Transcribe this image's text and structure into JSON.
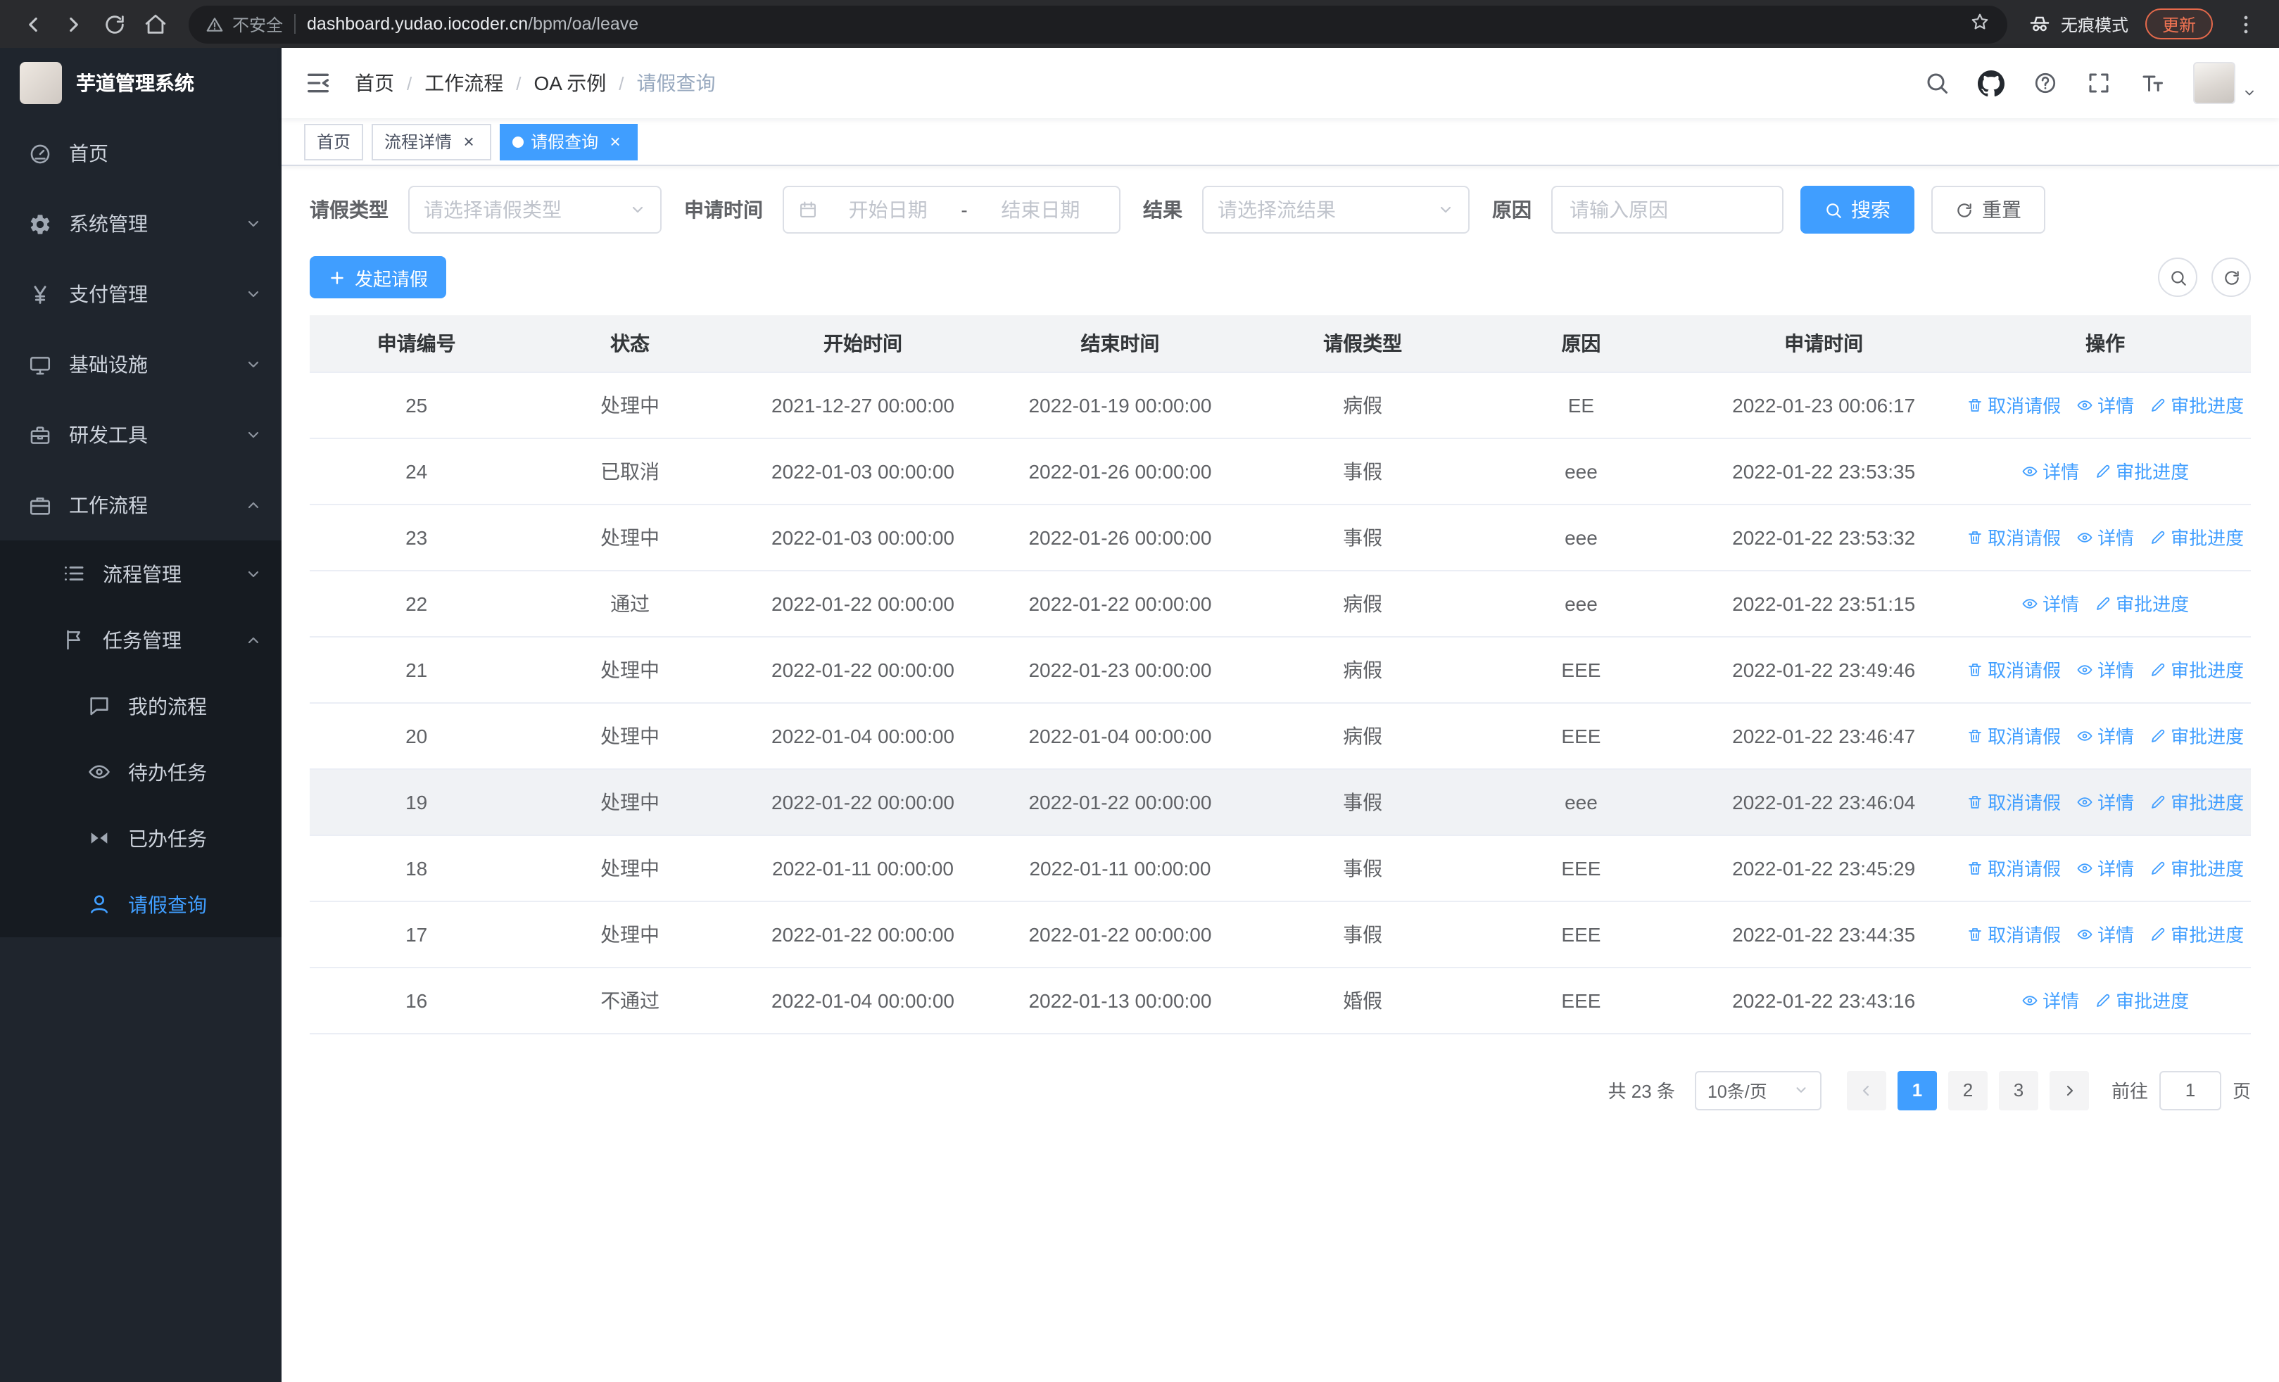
{
  "browser": {
    "security_label": "不安全",
    "url_domain": "dashboard.yudao.iocoder.cn",
    "url_path": "/bpm/oa/leave",
    "incognito_label": "无痕模式",
    "update_label": "更新"
  },
  "sidebar": {
    "logo_title": "芋道管理系统",
    "items": {
      "home": "首页",
      "system": "系统管理",
      "payment": "支付管理",
      "infra": "基础设施",
      "devtools": "研发工具",
      "workflow": "工作流程",
      "process_mgmt": "流程管理",
      "task_mgmt": "任务管理",
      "my_process": "我的流程",
      "todo_tasks": "待办任务",
      "done_tasks": "已办任务",
      "leave_query": "请假查询"
    }
  },
  "header": {
    "breadcrumb": [
      "首页",
      "工作流程",
      "OA 示例",
      "请假查询"
    ],
    "separator": "/"
  },
  "tabs": [
    {
      "label": "首页"
    },
    {
      "label": "流程详情"
    },
    {
      "label": "请假查询"
    }
  ],
  "glyphs": {
    "close": "×"
  },
  "filters": {
    "leave_type_label": "请假类型",
    "leave_type_placeholder": "请选择请假类型",
    "apply_time_label": "申请时间",
    "start_date_placeholder": "开始日期",
    "range_separator": "-",
    "end_date_placeholder": "结束日期",
    "result_label": "结果",
    "result_placeholder": "请选择流结果",
    "reason_label": "原因",
    "reason_placeholder": "请输入原因",
    "search_button": "搜索",
    "reset_button": "重置"
  },
  "toolbar": {
    "create_button": "发起请假"
  },
  "table": {
    "columns": [
      "申请编号",
      "状态",
      "开始时间",
      "结束时间",
      "请假类型",
      "原因",
      "申请时间",
      "操作"
    ],
    "action_labels": {
      "cancel": "取消请假",
      "detail": "详情",
      "progress": "审批进度"
    },
    "rows": [
      {
        "id": "25",
        "status": "处理中",
        "start": "2021-12-27 00:00:00",
        "end": "2022-01-19 00:00:00",
        "type": "病假",
        "reason": "EE",
        "apply": "2022-01-23 00:06:17",
        "actions": [
          "cancel",
          "detail",
          "progress"
        ]
      },
      {
        "id": "24",
        "status": "已取消",
        "start": "2022-01-03 00:00:00",
        "end": "2022-01-26 00:00:00",
        "type": "事假",
        "reason": "eee",
        "apply": "2022-01-22 23:53:35",
        "actions": [
          "detail",
          "progress"
        ]
      },
      {
        "id": "23",
        "status": "处理中",
        "start": "2022-01-03 00:00:00",
        "end": "2022-01-26 00:00:00",
        "type": "事假",
        "reason": "eee",
        "apply": "2022-01-22 23:53:32",
        "actions": [
          "cancel",
          "detail",
          "progress"
        ]
      },
      {
        "id": "22",
        "status": "通过",
        "start": "2022-01-22 00:00:00",
        "end": "2022-01-22 00:00:00",
        "type": "病假",
        "reason": "eee",
        "apply": "2022-01-22 23:51:15",
        "actions": [
          "detail",
          "progress"
        ]
      },
      {
        "id": "21",
        "status": "处理中",
        "start": "2022-01-22 00:00:00",
        "end": "2022-01-23 00:00:00",
        "type": "病假",
        "reason": "EEE",
        "apply": "2022-01-22 23:49:46",
        "actions": [
          "cancel",
          "detail",
          "progress"
        ]
      },
      {
        "id": "20",
        "status": "处理中",
        "start": "2022-01-04 00:00:00",
        "end": "2022-01-04 00:00:00",
        "type": "病假",
        "reason": "EEE",
        "apply": "2022-01-22 23:46:47",
        "actions": [
          "cancel",
          "detail",
          "progress"
        ]
      },
      {
        "id": "19",
        "status": "处理中",
        "start": "2022-01-22 00:00:00",
        "end": "2022-01-22 00:00:00",
        "type": "事假",
        "reason": "eee",
        "apply": "2022-01-22 23:46:04",
        "actions": [
          "cancel",
          "detail",
          "progress"
        ],
        "highlight": true
      },
      {
        "id": "18",
        "status": "处理中",
        "start": "2022-01-11 00:00:00",
        "end": "2022-01-11 00:00:00",
        "type": "事假",
        "reason": "EEE",
        "apply": "2022-01-22 23:45:29",
        "actions": [
          "cancel",
          "detail",
          "progress"
        ]
      },
      {
        "id": "17",
        "status": "处理中",
        "start": "2022-01-22 00:00:00",
        "end": "2022-01-22 00:00:00",
        "type": "事假",
        "reason": "EEE",
        "apply": "2022-01-22 23:44:35",
        "actions": [
          "cancel",
          "detail",
          "progress"
        ]
      },
      {
        "id": "16",
        "status": "不通过",
        "start": "2022-01-04 00:00:00",
        "end": "2022-01-13 00:00:00",
        "type": "婚假",
        "reason": "EEE",
        "apply": "2022-01-22 23:43:16",
        "actions": [
          "detail",
          "progress"
        ]
      }
    ]
  },
  "pagination": {
    "total_text": "共 23 条",
    "page_size": "10条/页",
    "pages": [
      "1",
      "2",
      "3"
    ],
    "active_page": "1",
    "goto_label": "前往",
    "goto_value": "1",
    "page_unit": "页"
  },
  "colors": {
    "primary": "#409eff",
    "sidebar_bg": "#1f252d",
    "submenu_bg": "#161b21"
  }
}
